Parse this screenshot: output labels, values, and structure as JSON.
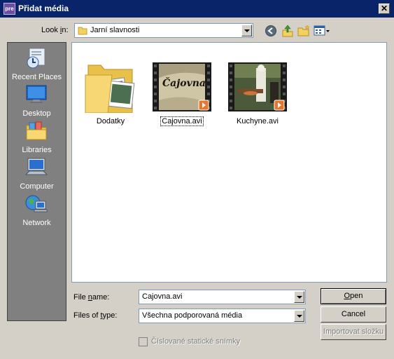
{
  "window": {
    "title": "Přidat média",
    "app_icon_text": "pre",
    "close_glyph": "✕"
  },
  "toolbar": {
    "look_in_label_pre": "Look ",
    "look_in_label_u": "i",
    "look_in_label_post": "n:",
    "look_in_value": "Jarní slavnosti",
    "icons": [
      "back-icon",
      "up-folder-icon",
      "new-folder-icon",
      "view-menu-icon"
    ]
  },
  "places": [
    {
      "label": "Recent Places",
      "icon": "recent-places-icon"
    },
    {
      "label": "Desktop",
      "icon": "desktop-icon"
    },
    {
      "label": "Libraries",
      "icon": "libraries-icon"
    },
    {
      "label": "Computer",
      "icon": "computer-icon"
    },
    {
      "label": "Network",
      "icon": "network-icon"
    }
  ],
  "files": [
    {
      "label": "Dodatky",
      "kind": "folder"
    },
    {
      "label": "Cajovna.avi",
      "kind": "video",
      "thumb_text": "Čajovna"
    },
    {
      "label": "Kuchyne.avi",
      "kind": "video"
    }
  ],
  "form": {
    "file_name_label_pre": "File ",
    "file_name_label_u": "n",
    "file_name_label_post": "ame:",
    "file_name_value": "Cajovna.avi",
    "file_type_label_pre": "Files of ",
    "file_type_label_u": "t",
    "file_type_label_post": "ype:",
    "file_type_value": "Všechna podporovaná média"
  },
  "buttons": {
    "open_u": "O",
    "open_rest": "pen",
    "cancel": "Cancel",
    "import": "Importovat složku"
  },
  "checkbox": {
    "label": "Číslované statické snímky",
    "checked": false
  }
}
